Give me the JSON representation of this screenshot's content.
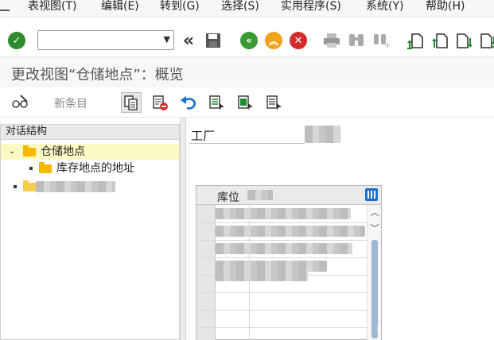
{
  "menu": {
    "items": [
      "表视图(T)",
      "编辑(E)",
      "转到(G)",
      "选择(S)",
      "实用程序(S)",
      "系统(Y)",
      "帮助(H)"
    ]
  },
  "toolbar": {
    "command_value": "",
    "icons": [
      "enter-check-icon",
      "save-icon",
      "back-icon",
      "exit-icon",
      "cancel-icon",
      "print-icon",
      "find-icon",
      "find-next-icon",
      "first-page-icon",
      "previous-page-icon",
      "next-page-icon",
      "last-page-icon"
    ]
  },
  "page": {
    "title": "更改视图“仓储地点”：概览",
    "new_entry_label": "新条目"
  },
  "tree": {
    "header": "对话结构",
    "node_storage": "仓储地点",
    "node_address": "库存地点的地址"
  },
  "detail": {
    "plant_label": "工厂",
    "table_col_header": "库位"
  },
  "colors": {
    "enter_green": "#2e8b2e",
    "back_green": "#3a9a32",
    "exit_orange": "#f0a418",
    "cancel_red": "#d42a2a",
    "folder_yellow": "#f5b700",
    "selection_yellow": "#fdf9c2"
  }
}
